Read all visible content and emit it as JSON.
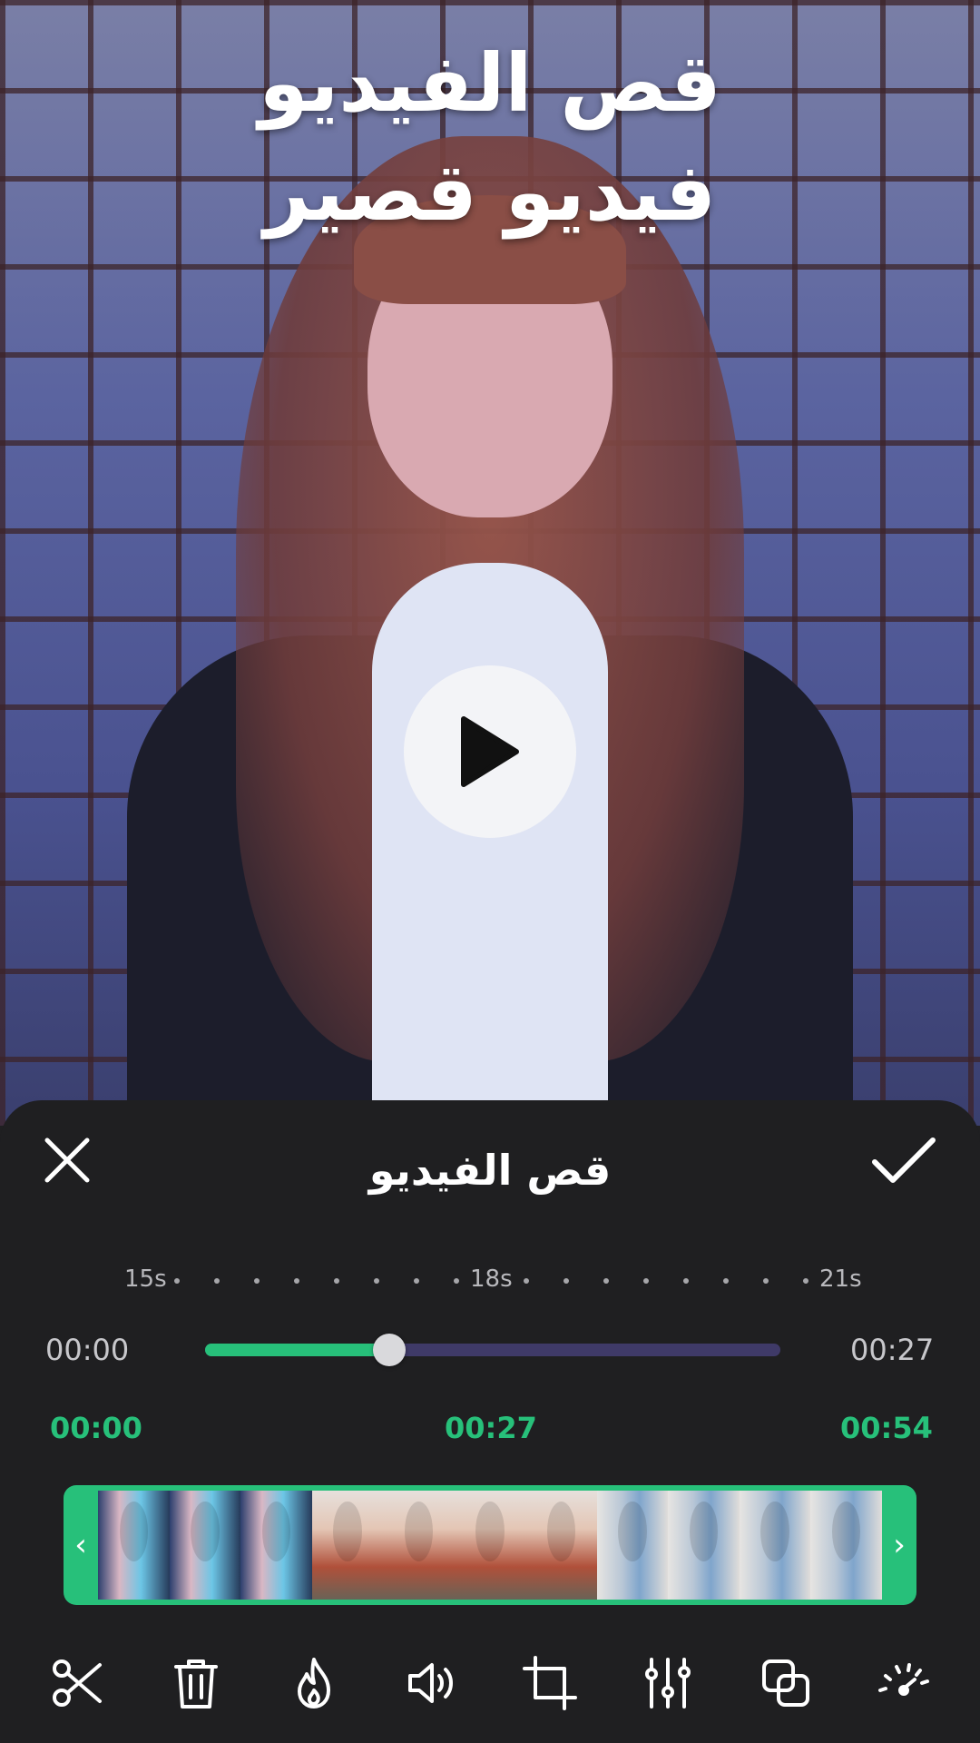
{
  "preview": {
    "overlay_line1": "قص الفيديو",
    "overlay_line2": "فيديو قصير",
    "play_icon": "play-icon"
  },
  "sheet": {
    "title": "قص الفيديو",
    "close_icon": "close-icon",
    "confirm_icon": "check-icon"
  },
  "ruler": {
    "labels": [
      "15s",
      "18s",
      "21s"
    ]
  },
  "playback": {
    "start_time": "00:00",
    "end_time": "00:27",
    "progress": 0.32
  },
  "trim_marks": {
    "start": "00:00",
    "middle": "00:27",
    "end": "00:54"
  },
  "filmstrip": {
    "left_handle": "‹",
    "right_handle": "›"
  },
  "toolbar": {
    "tools": [
      "scissors-icon",
      "trash-icon",
      "flame-icon",
      "volume-icon",
      "crop-icon",
      "sliders-icon",
      "duplicate-icon",
      "speed-icon"
    ]
  },
  "colors": {
    "accent": "#27c07a",
    "track": "#3f3a68",
    "sheet_bg": "#1f1f21"
  }
}
